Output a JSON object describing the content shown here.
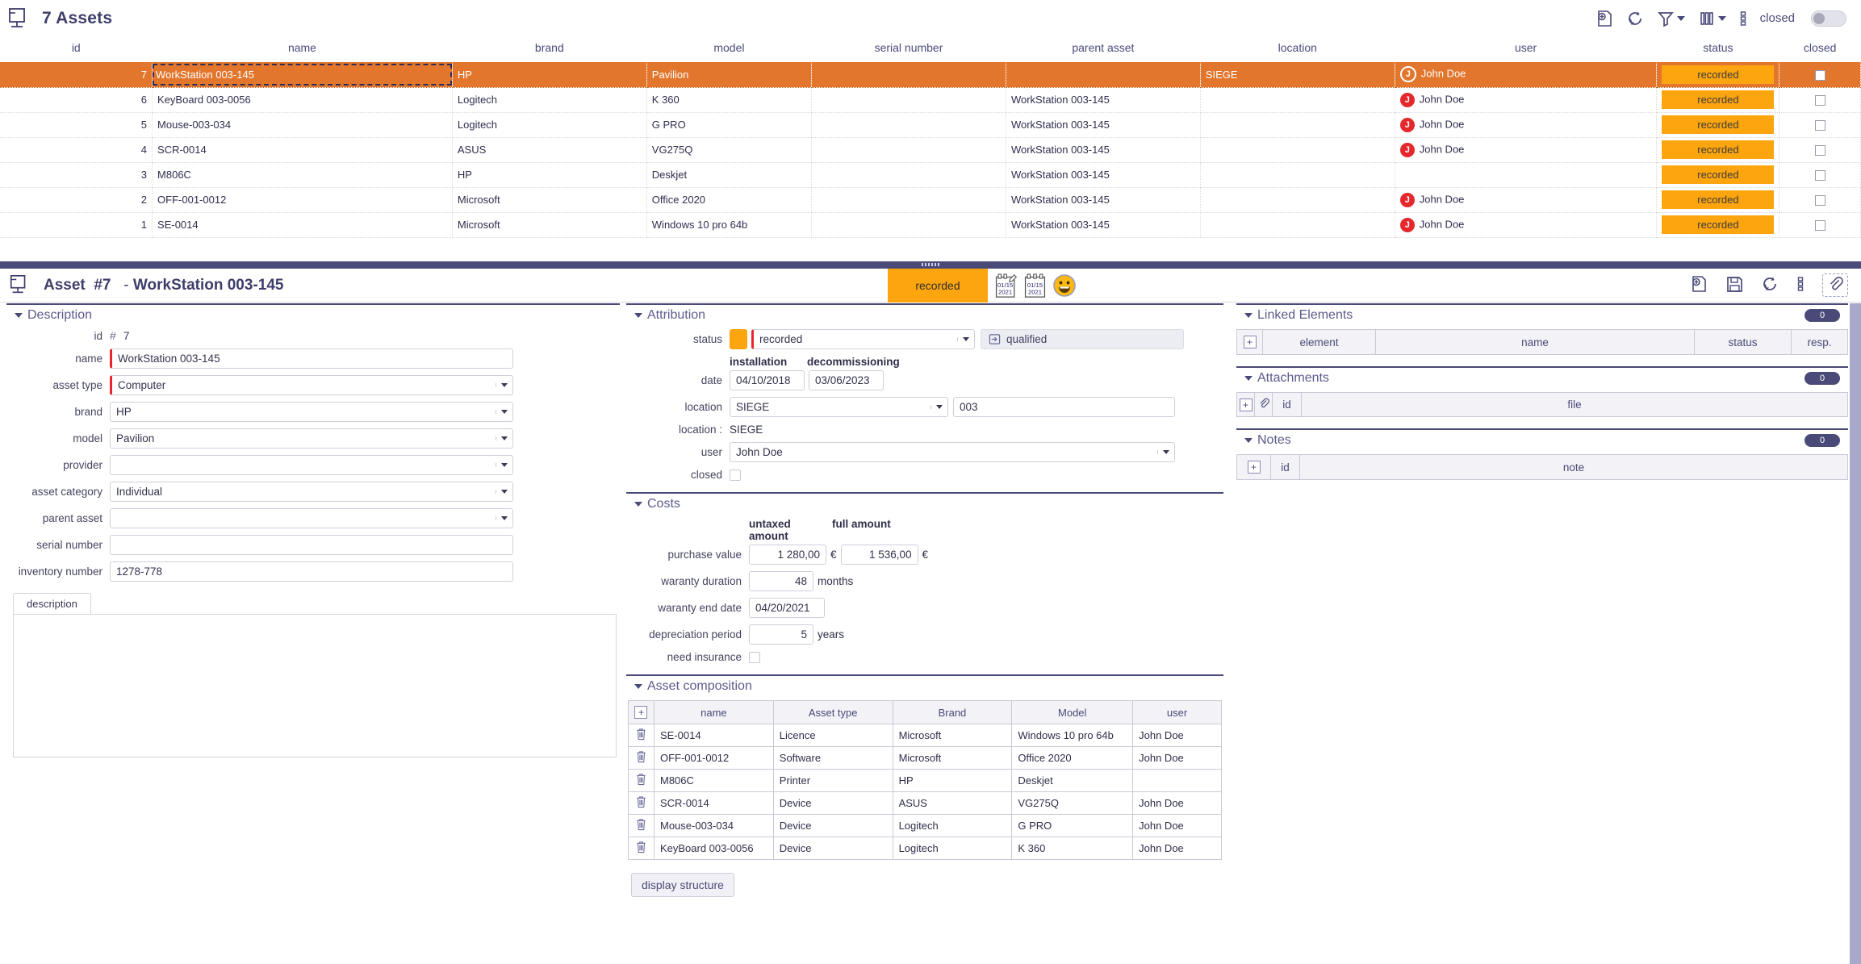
{
  "list": {
    "title": "7 Assets",
    "toolbar": {
      "add_label": "add-record-icon",
      "refresh_label": "refresh-icon",
      "filter_label": "filter-icon",
      "columns_label": "columns-icon",
      "more_label": "more-options-icon",
      "closed_label": "closed"
    },
    "columns": [
      "id",
      "name",
      "brand",
      "model",
      "serial number",
      "parent asset",
      "location",
      "user",
      "status",
      "closed"
    ],
    "rows": [
      {
        "id": "7",
        "name": "WorkStation 003-145",
        "brand": "HP",
        "model": "Pavilion",
        "serial": "",
        "parent": "",
        "location": "SIEGE",
        "user": "John Doe",
        "user_initial": "J",
        "status": "recorded",
        "closed": false,
        "selected": true
      },
      {
        "id": "6",
        "name": "KeyBoard 003-0056",
        "brand": "Logitech",
        "model": "K 360",
        "serial": "",
        "parent": "WorkStation 003-145",
        "location": "",
        "user": "John Doe",
        "user_initial": "J",
        "status": "recorded",
        "closed": false,
        "selected": false
      },
      {
        "id": "5",
        "name": "Mouse-003-034",
        "brand": "Logitech",
        "model": "G PRO",
        "serial": "",
        "parent": "WorkStation 003-145",
        "location": "",
        "user": "John Doe",
        "user_initial": "J",
        "status": "recorded",
        "closed": false,
        "selected": false
      },
      {
        "id": "4",
        "name": "SCR-0014",
        "brand": "ASUS",
        "model": "VG275Q",
        "serial": "",
        "parent": "WorkStation 003-145",
        "location": "",
        "user": "John Doe",
        "user_initial": "J",
        "status": "recorded",
        "closed": false,
        "selected": false
      },
      {
        "id": "3",
        "name": "M806C",
        "brand": "HP",
        "model": "Deskjet",
        "serial": "",
        "parent": "WorkStation 003-145",
        "location": "",
        "user": "",
        "user_initial": "",
        "status": "recorded",
        "closed": false,
        "selected": false
      },
      {
        "id": "2",
        "name": "OFF-001-0012",
        "brand": "Microsoft",
        "model": "Office 2020",
        "serial": "",
        "parent": "WorkStation 003-145",
        "location": "",
        "user": "John Doe",
        "user_initial": "J",
        "status": "recorded",
        "closed": false,
        "selected": false
      },
      {
        "id": "1",
        "name": "SE-0014",
        "brand": "Microsoft",
        "model": "Windows 10 pro 64b",
        "serial": "",
        "parent": "WorkStation 003-145",
        "location": "",
        "user": "John Doe",
        "user_initial": "J",
        "status": "recorded",
        "closed": false,
        "selected": false
      }
    ]
  },
  "detail_header": {
    "entity": "Asset",
    "number": "#7",
    "separator": "-",
    "record_name": "WorkStation 003-145",
    "status": "recorded",
    "date_created_month": "01/15",
    "date_created_year": "2021",
    "date_modified_month": "01/15",
    "date_modified_year": "2021"
  },
  "description": {
    "title": "Description",
    "id_label": "id",
    "id_hash": "#",
    "id_value": "7",
    "name_label": "name",
    "name_value": "WorkStation 003-145",
    "asset_type_label": "asset type",
    "asset_type_value": "Computer",
    "brand_label": "brand",
    "brand_value": "HP",
    "model_label": "model",
    "model_value": "Pavilion",
    "provider_label": "provider",
    "provider_value": "",
    "asset_category_label": "asset category",
    "asset_category_value": "Individual",
    "parent_asset_label": "parent asset",
    "parent_asset_value": "",
    "serial_number_label": "serial number",
    "serial_number_value": "",
    "inventory_number_label": "inventory number",
    "inventory_number_value": "1278-778",
    "tab_label": "description",
    "textarea_value": ""
  },
  "attribution": {
    "title": "Attribution",
    "status_label": "status",
    "status_value": "recorded",
    "status_color": "#fda50f",
    "qualified_label": "qualified",
    "installation_label": "installation",
    "decommissioning_label": "decommissioning",
    "date_label": "date",
    "installation_date": "04/10/2018",
    "decommissioning_date": "03/06/2023",
    "location_label": "location",
    "location_value": "SIEGE",
    "location_detail": "003",
    "location_static_label": "location :",
    "location_static_value": "SIEGE",
    "user_label": "user",
    "user_value": "John Doe",
    "closed_label": "closed",
    "closed_value": false
  },
  "costs": {
    "title": "Costs",
    "untaxed_header": "untaxed amount",
    "full_header": "full amount",
    "purchase_value_label": "purchase value",
    "purchase_untaxed": "1 280,00",
    "purchase_full": "1 536,00",
    "currency": "€",
    "waranty_duration_label": "waranty duration",
    "waranty_duration_value": "48",
    "months_unit": "months",
    "waranty_end_label": "waranty end date",
    "waranty_end_value": "04/20/2021",
    "depreciation_label": "depreciation period",
    "depreciation_value": "5",
    "years_unit": "years",
    "insurance_label": "need insurance",
    "insurance_value": false
  },
  "composition": {
    "title": "Asset composition",
    "columns": [
      "name",
      "Asset type",
      "Brand",
      "Model",
      "user"
    ],
    "rows": [
      {
        "name": "SE-0014",
        "type": "Licence",
        "brand": "Microsoft",
        "model": "Windows 10 pro 64b",
        "user": "John Doe"
      },
      {
        "name": "OFF-001-0012",
        "type": "Software",
        "brand": "Microsoft",
        "model": "Office 2020",
        "user": "John Doe"
      },
      {
        "name": "M806C",
        "type": "Printer",
        "brand": "HP",
        "model": "Deskjet",
        "user": ""
      },
      {
        "name": "SCR-0014",
        "type": "Device",
        "brand": "ASUS",
        "model": "VG275Q",
        "user": "John Doe"
      },
      {
        "name": "Mouse-003-034",
        "type": "Device",
        "brand": "Logitech",
        "model": "G PRO",
        "user": "John Doe"
      },
      {
        "name": "KeyBoard 003-0056",
        "type": "Device",
        "brand": "Logitech",
        "model": "K 360",
        "user": "John Doe"
      }
    ],
    "display_structure_label": "display structure"
  },
  "linked_elements": {
    "title": "Linked Elements",
    "count": "0",
    "columns": [
      "element",
      "name",
      "status",
      "resp."
    ]
  },
  "attachments": {
    "title": "Attachments",
    "count": "0",
    "columns": [
      "id",
      "file"
    ]
  },
  "notes": {
    "title": "Notes",
    "count": "0",
    "columns": [
      "id",
      "note"
    ]
  }
}
